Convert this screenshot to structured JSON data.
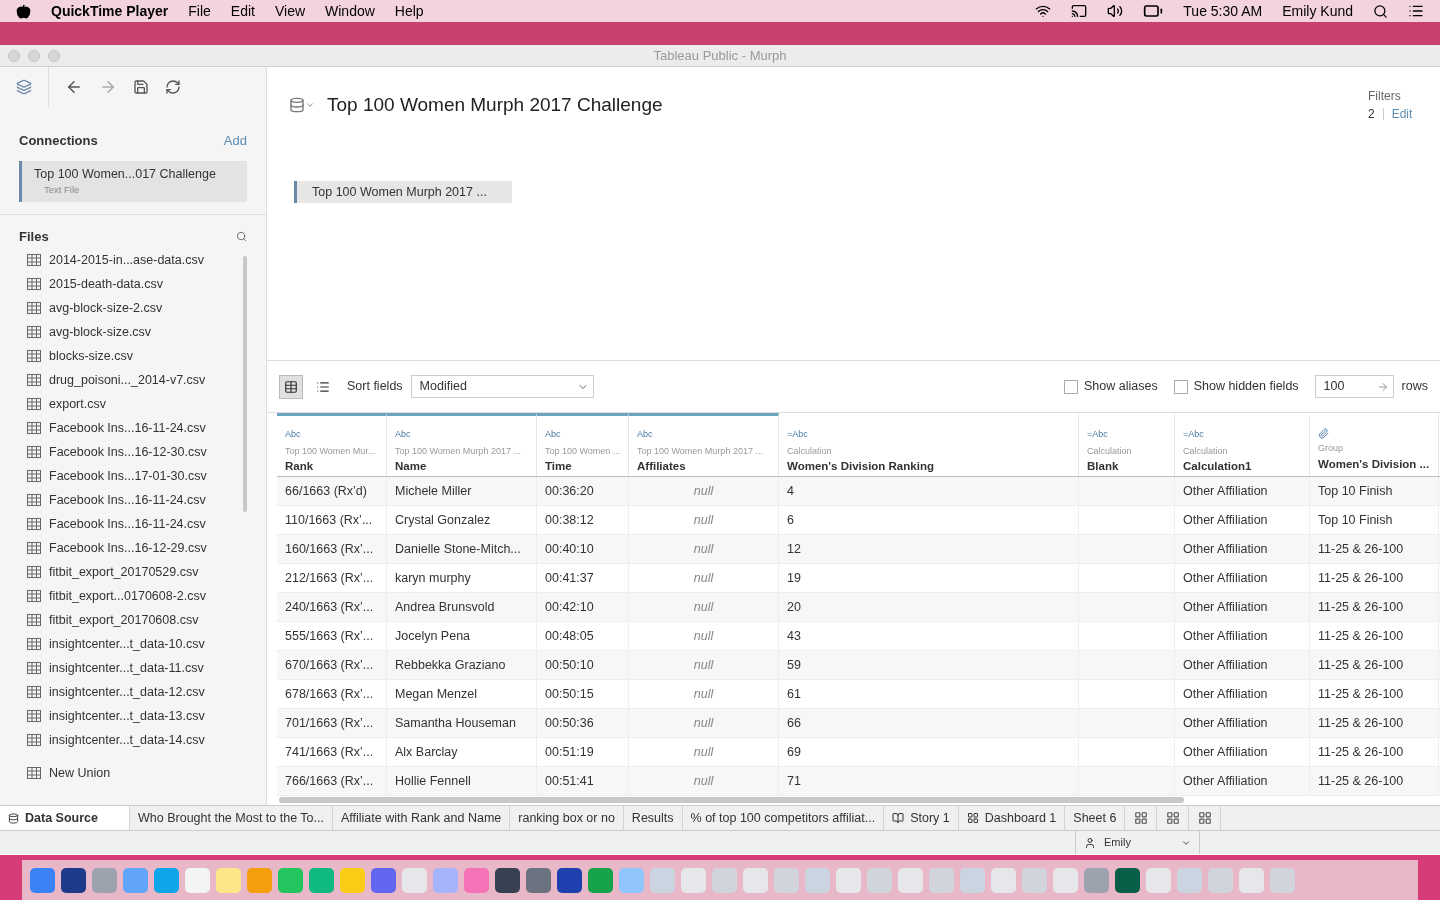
{
  "menu_bar": {
    "app": "QuickTime Player",
    "menus": [
      "File",
      "Edit",
      "View",
      "Window",
      "Help"
    ],
    "clock": "Tue 5:30 AM",
    "user": "Emily Kund"
  },
  "window": {
    "title": "Tableau Public - Murph"
  },
  "connections": {
    "title": "Connections",
    "add": "Add",
    "items": [
      {
        "name": "Top 100 Women...017 Challenge",
        "type": "Text File",
        "selected": true
      }
    ]
  },
  "files": {
    "title": "Files",
    "items": [
      "2014-2015-in...ase-data.csv",
      "2015-death-data.csv",
      "avg-block-size-2.csv",
      "avg-block-size.csv",
      "blocks-size.csv",
      "drug_poisoni..._2014-v7.csv",
      "export.csv",
      "Facebook Ins...16-11-24.csv",
      "Facebook Ins...16-12-30.csv",
      "Facebook Ins...17-01-30.csv",
      "Facebook Ins...16-11-24.csv",
      "Facebook Ins...16-11-24.csv",
      "Facebook Ins...16-12-29.csv",
      "fitbit_export_20170529.csv",
      "fitbit_export...0170608-2.csv",
      "fitbit_export_20170608.csv",
      "insightcenter...t_data-10.csv",
      "insightcenter...t_data-11.csv",
      "insightcenter...t_data-12.csv",
      "insightcenter...t_data-13.csv",
      "insightcenter...t_data-14.csv"
    ],
    "new_union": "New Union"
  },
  "canvas": {
    "title": "Top 100 Women Murph 2017 Challenge",
    "table_chip": "Top 100 Women Murph 2017 ...",
    "filters": {
      "label": "Filters",
      "count": "2",
      "edit": "Edit"
    }
  },
  "grid_toolbar": {
    "grid_view_selected": true,
    "sort_label": "Sort fields",
    "sort_value": "Modified",
    "show_aliases": {
      "label": "Show aliases",
      "checked": false
    },
    "show_hidden": {
      "label": "Show hidden fields",
      "checked": false
    },
    "rows_value": "100",
    "rows_label": "rows"
  },
  "table": {
    "columns": [
      {
        "kind": "source",
        "type": "Abc",
        "origin": "Top 100 Women Mur...",
        "name": "Rank"
      },
      {
        "kind": "source",
        "type": "Abc",
        "origin": "Top 100 Women Murph 2017 ...",
        "name": "Name"
      },
      {
        "kind": "source",
        "type": "Abc",
        "origin": "Top 100 Women ...",
        "name": "Time"
      },
      {
        "kind": "source",
        "type": "Abc",
        "origin": "Top 100 Women Murph 2017 ...",
        "name": "Affiliates"
      },
      {
        "kind": "calculation",
        "type": "=Abc",
        "origin": "Calculation",
        "name": "Women's Division Ranking"
      },
      {
        "kind": "calculation",
        "type": "=Abc",
        "origin": "Calculation",
        "name": "Blank"
      },
      {
        "kind": "calculation",
        "type": "=Abc",
        "origin": "Calculation",
        "name": "Calculation1"
      },
      {
        "kind": "group",
        "origin": "Group",
        "name": "Women's Division ..."
      }
    ],
    "rows": [
      [
        "66/1663 (Rx’d)",
        "Michele Miller",
        "00:36:20",
        "null",
        "4",
        "",
        "Other Affiliation",
        "Top 10 Finish"
      ],
      [
        "110/1663 (Rx’...",
        "Crystal Gonzalez",
        "00:38:12",
        "null",
        "6",
        "",
        "Other Affiliation",
        "Top 10 Finish"
      ],
      [
        "160/1663 (Rx’...",
        "Danielle Stone-Mitch...",
        "00:40:10",
        "null",
        "12",
        "",
        "Other Affiliation",
        "11-25 & 26-100"
      ],
      [
        "212/1663 (Rx’...",
        "karyn murphy",
        "00:41:37",
        "null",
        "19",
        "",
        "Other Affiliation",
        "11-25 & 26-100"
      ],
      [
        "240/1663 (Rx’...",
        "Andrea Brunsvold",
        "00:42:10",
        "null",
        "20",
        "",
        "Other Affiliation",
        "11-25 & 26-100"
      ],
      [
        "555/1663 (Rx’...",
        "Jocelyn Pena",
        "00:48:05",
        "null",
        "43",
        "",
        "Other Affiliation",
        "11-25 & 26-100"
      ],
      [
        "670/1663 (Rx’...",
        "Rebbekka Graziano",
        "00:50:10",
        "null",
        "59",
        "",
        "Other Affiliation",
        "11-25 & 26-100"
      ],
      [
        "678/1663 (Rx’...",
        "Megan Menzel",
        "00:50:15",
        "null",
        "61",
        "",
        "Other Affiliation",
        "11-25 & 26-100"
      ],
      [
        "701/1663 (Rx’...",
        "Samantha Houseman",
        "00:50:36",
        "null",
        "66",
        "",
        "Other Affiliation",
        "11-25 & 26-100"
      ],
      [
        "741/1663 (Rx’...",
        "Alx Barclay",
        "00:51:19",
        "null",
        "69",
        "",
        "Other Affiliation",
        "11-25 & 26-100"
      ],
      [
        "766/1663 (Rx’...",
        "Hollie Fennell",
        "00:51:41",
        "null",
        "71",
        "",
        "Other Affiliation",
        "11-25 & 26-100"
      ]
    ]
  },
  "sheet_tabs": [
    {
      "kind": "datasource",
      "label": "Data Source",
      "selected": true
    },
    {
      "kind": "sheet",
      "label": "Who Brought the Most to the To...",
      "selected": false
    },
    {
      "kind": "sheet",
      "label": "Affiliate with Rank and Name",
      "selected": false
    },
    {
      "kind": "sheet",
      "label": "ranking box or no",
      "selected": false
    },
    {
      "kind": "sheet",
      "label": "Results",
      "selected": false
    },
    {
      "kind": "sheet",
      "label": "% of top 100 competitors affiliat...",
      "selected": false
    },
    {
      "kind": "story",
      "label": "Story 1",
      "selected": false
    },
    {
      "kind": "dashboard",
      "label": "Dashboard 1",
      "selected": false
    },
    {
      "kind": "sheet",
      "label": "Sheet 6",
      "selected": false
    }
  ],
  "status_bar": {
    "user": "Emily"
  }
}
